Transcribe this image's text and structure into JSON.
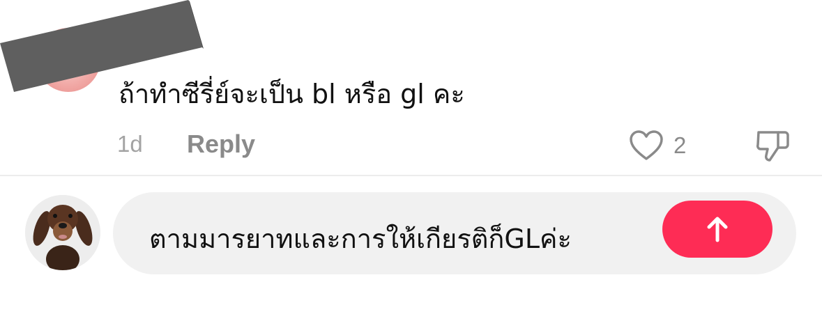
{
  "comment": {
    "text": "ถ้าทำซีรี่ย์จะเป็น bl หรือ gl คะ",
    "time": "1d",
    "reply_label": "Reply",
    "like_count": "2",
    "icons": {
      "like": "heart-outline-icon",
      "dislike": "thumbs-down-icon"
    }
  },
  "composer": {
    "text": "ตามมารยาทและการให้เกียรติก็GLค่ะ",
    "send_icon": "arrow-up-icon",
    "send_color": "#fe2c55"
  },
  "colors": {
    "redaction": "#5f5f5f",
    "muted_text": "#a3a3a3"
  }
}
